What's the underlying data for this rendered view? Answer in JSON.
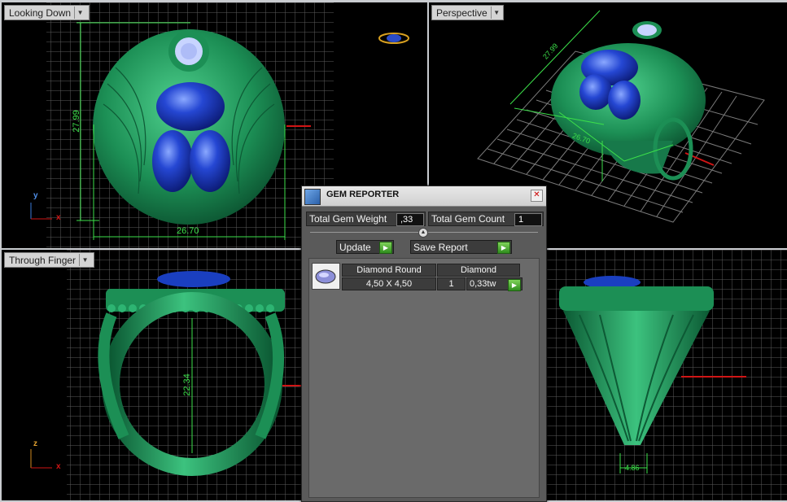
{
  "viewports": {
    "looking_down": {
      "label": "Looking Down",
      "dim_vertical": "27.99",
      "dim_horizontal": "26.70",
      "axis_y": "y",
      "axis_x": "x"
    },
    "perspective": {
      "label": "Perspective",
      "dim_a": "27.99",
      "dim_b": "26.70"
    },
    "through_finger": {
      "label": "Through Finger",
      "dim_vertical": "22.34",
      "axis_z": "z",
      "axis_x": "x"
    },
    "side": {
      "dim_bottom": "4.86"
    }
  },
  "gem_reporter": {
    "title": "GEM REPORTER",
    "close_glyph": "✕",
    "total_weight_label": "Total Gem Weight",
    "total_weight_value": ",33",
    "total_count_label": "Total Gem Count",
    "total_count_value": "1",
    "update_label": "Update",
    "save_report_label": "Save Report",
    "gems": [
      {
        "cut": "Diamond Round",
        "material": "Diamond",
        "size": "4,50 X 4,50",
        "qty": "1",
        "weight": "0,33tw"
      }
    ]
  },
  "colors": {
    "metal": "#1e9a5e",
    "gem_blue": "#1a3fc0",
    "dimension": "#3ce04a",
    "grid": "#6a6a6a",
    "axis_red": "#d01515",
    "panel_bg": "#5a5a5a"
  }
}
